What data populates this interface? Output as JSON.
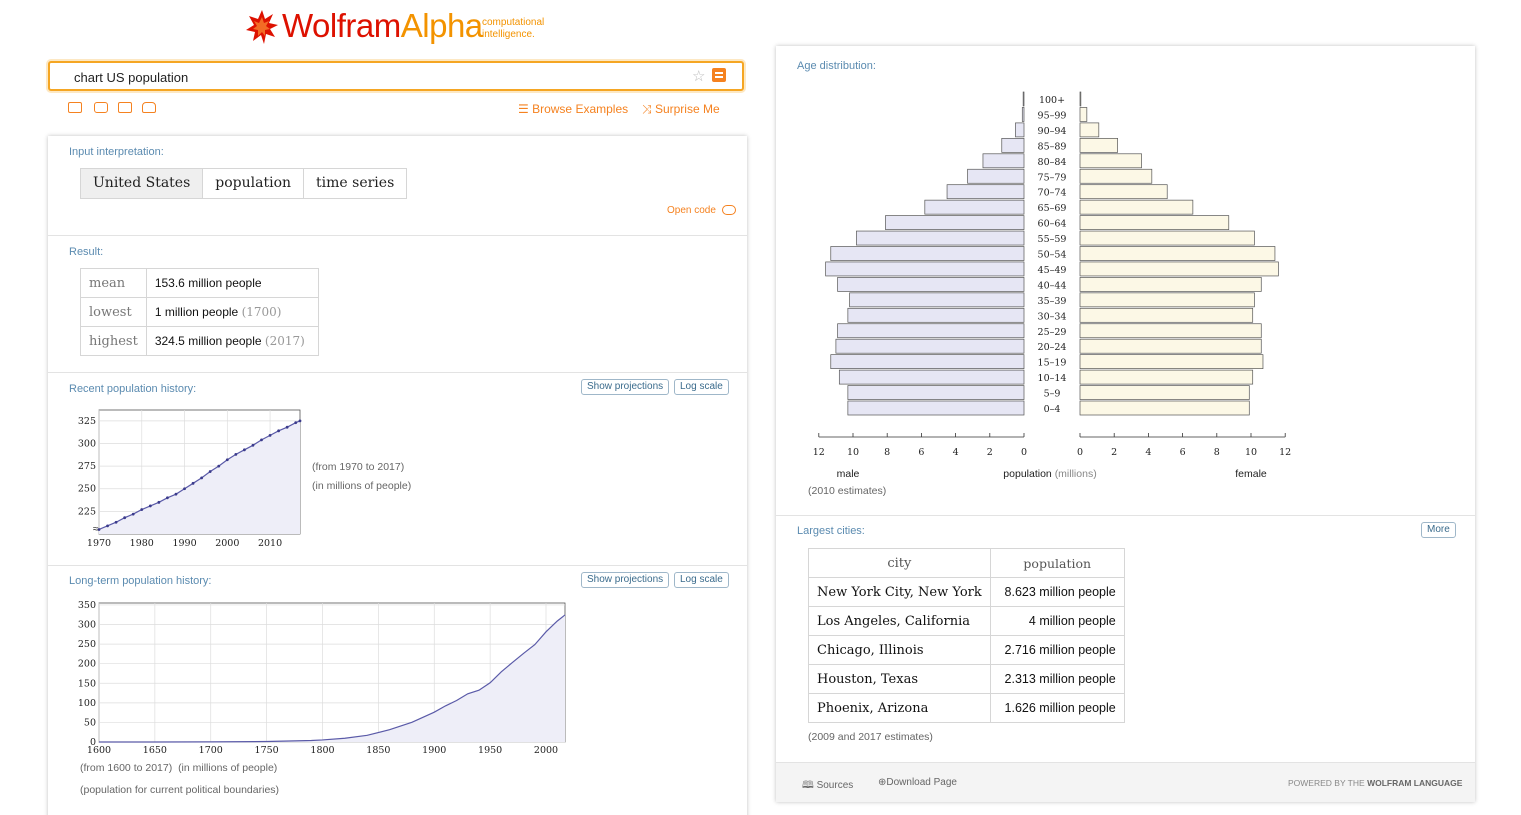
{
  "brand": {
    "name_part1": "Wolfram",
    "name_part2": "Alpha",
    "tagline_line1": "computational",
    "tagline_line2": "intelligence."
  },
  "search": {
    "query": "chart US population"
  },
  "nav": {
    "browse_examples": "Browse Examples",
    "surprise_me": "Surprise Me"
  },
  "input_interpretation": {
    "title": "Input interpretation:",
    "chips": [
      "United States",
      "population",
      "time series"
    ],
    "open_code": "Open code"
  },
  "result": {
    "title": "Result:",
    "rows": [
      {
        "key": "mean",
        "value": "153.6 million people",
        "note": ""
      },
      {
        "key": "lowest",
        "value": "1 million people",
        "note": "(1700)"
      },
      {
        "key": "highest",
        "value": "324.5 million people",
        "note": "(2017)"
      }
    ]
  },
  "recent_history": {
    "title": "Recent population history:",
    "show_projections": "Show projections",
    "log_scale": "Log scale",
    "range_note": "(from 1970 to 2017)",
    "unit_note": "(in millions of people)"
  },
  "longterm_history": {
    "title": "Long-term population history:",
    "show_projections": "Show projections",
    "log_scale": "Log scale",
    "range_note": "(from 1600 to 2017)",
    "unit_note": "(in millions of people)",
    "boundary_note": "(population for current political boundaries)"
  },
  "age_distribution": {
    "title": "Age distribution:",
    "male_label": "male",
    "female_label": "female",
    "axis_label": "population",
    "axis_unit": "(millions)",
    "estimates_note": "(2010 estimates)"
  },
  "largest_cities": {
    "title": "Largest cities:",
    "more": "More",
    "header_city": "city",
    "header_population": "population",
    "rows": [
      {
        "city": "New York City, New York",
        "population": "8.623 million people"
      },
      {
        "city": "Los Angeles, California",
        "population": "4 million people"
      },
      {
        "city": "Chicago, Illinois",
        "population": "2.716 million people"
      },
      {
        "city": "Houston, Texas",
        "population": "2.313 million people"
      },
      {
        "city": "Phoenix, Arizona",
        "population": "1.626 million people"
      }
    ],
    "estimates_note": "(2009 and 2017 estimates)"
  },
  "footer": {
    "sources": "Sources",
    "download_page": "Download Page",
    "powered_prefix": "POWERED BY THE",
    "powered_brand": "WOLFRAM LANGUAGE"
  },
  "colors": {
    "accent_orange": "#f58220",
    "logo_red": "#dd1100",
    "pod_title_blue": "#5b8bb0",
    "male_fill": "#e6e6f4",
    "female_fill": "#fcf8e6",
    "line_color": "#5a5aa8"
  },
  "chart_data": [
    {
      "type": "line",
      "id": "recent",
      "x": [
        1970,
        1972,
        1974,
        1976,
        1978,
        1980,
        1982,
        1984,
        1986,
        1988,
        1990,
        1992,
        1994,
        1996,
        1998,
        2000,
        2002,
        2004,
        2006,
        2008,
        2010,
        2012,
        2014,
        2016,
        2017
      ],
      "values": [
        205,
        209,
        213,
        218,
        222,
        227,
        231,
        235,
        240,
        244,
        250,
        256,
        262,
        269,
        275,
        282,
        288,
        293,
        298,
        304,
        309,
        314,
        318,
        323,
        325
      ],
      "xticks": [
        1970,
        1980,
        1990,
        2000,
        2010
      ],
      "yticks": [
        225,
        250,
        275,
        300,
        325
      ],
      "xlim": [
        1970,
        2017
      ],
      "ylim": [
        200,
        337
      ],
      "grid": true
    },
    {
      "type": "area",
      "id": "longterm",
      "x": [
        1600,
        1650,
        1700,
        1750,
        1790,
        1800,
        1820,
        1840,
        1860,
        1880,
        1900,
        1910,
        1920,
        1930,
        1940,
        1950,
        1960,
        1970,
        1980,
        1990,
        2000,
        2010,
        2017
      ],
      "values": [
        0.05,
        0.05,
        0.25,
        1.2,
        3.9,
        5.3,
        9.6,
        17.1,
        31.4,
        50.2,
        76.2,
        92.2,
        106,
        123.2,
        132.2,
        151.3,
        179.3,
        203.2,
        226.5,
        248.7,
        281.4,
        308.7,
        324.5
      ],
      "xticks": [
        1600,
        1650,
        1700,
        1750,
        1800,
        1850,
        1900,
        1950,
        2000
      ],
      "yticks": [
        0,
        50,
        100,
        150,
        200,
        250,
        300,
        350
      ],
      "xlim": [
        1600,
        2017
      ],
      "ylim": [
        0,
        355
      ],
      "grid": true
    },
    {
      "type": "bar",
      "id": "age_pyramid",
      "categories": [
        "100+",
        "95–99",
        "90–94",
        "85–89",
        "80–84",
        "75–79",
        "70–74",
        "65–69",
        "60–64",
        "55–59",
        "50–54",
        "45–49",
        "40–44",
        "35–39",
        "30–34",
        "25–29",
        "20–24",
        "15–19",
        "10–14",
        "5–9",
        "0–4"
      ],
      "series": [
        {
          "name": "male",
          "values": [
            0.05,
            0.1,
            0.5,
            1.3,
            2.4,
            3.3,
            4.5,
            5.8,
            8.1,
            9.8,
            11.3,
            11.6,
            10.9,
            10.2,
            10.3,
            10.9,
            11.0,
            11.3,
            10.8,
            10.3,
            10.3
          ]
        },
        {
          "name": "female",
          "values": [
            0.05,
            0.4,
            1.1,
            2.2,
            3.6,
            4.2,
            5.1,
            6.6,
            8.7,
            10.2,
            11.4,
            11.6,
            10.6,
            10.2,
            10.1,
            10.6,
            10.6,
            10.7,
            10.1,
            9.9,
            9.9
          ]
        }
      ],
      "xticks": [
        12,
        10,
        8,
        6,
        4,
        2,
        0
      ],
      "xlim": [
        0,
        12
      ]
    }
  ]
}
